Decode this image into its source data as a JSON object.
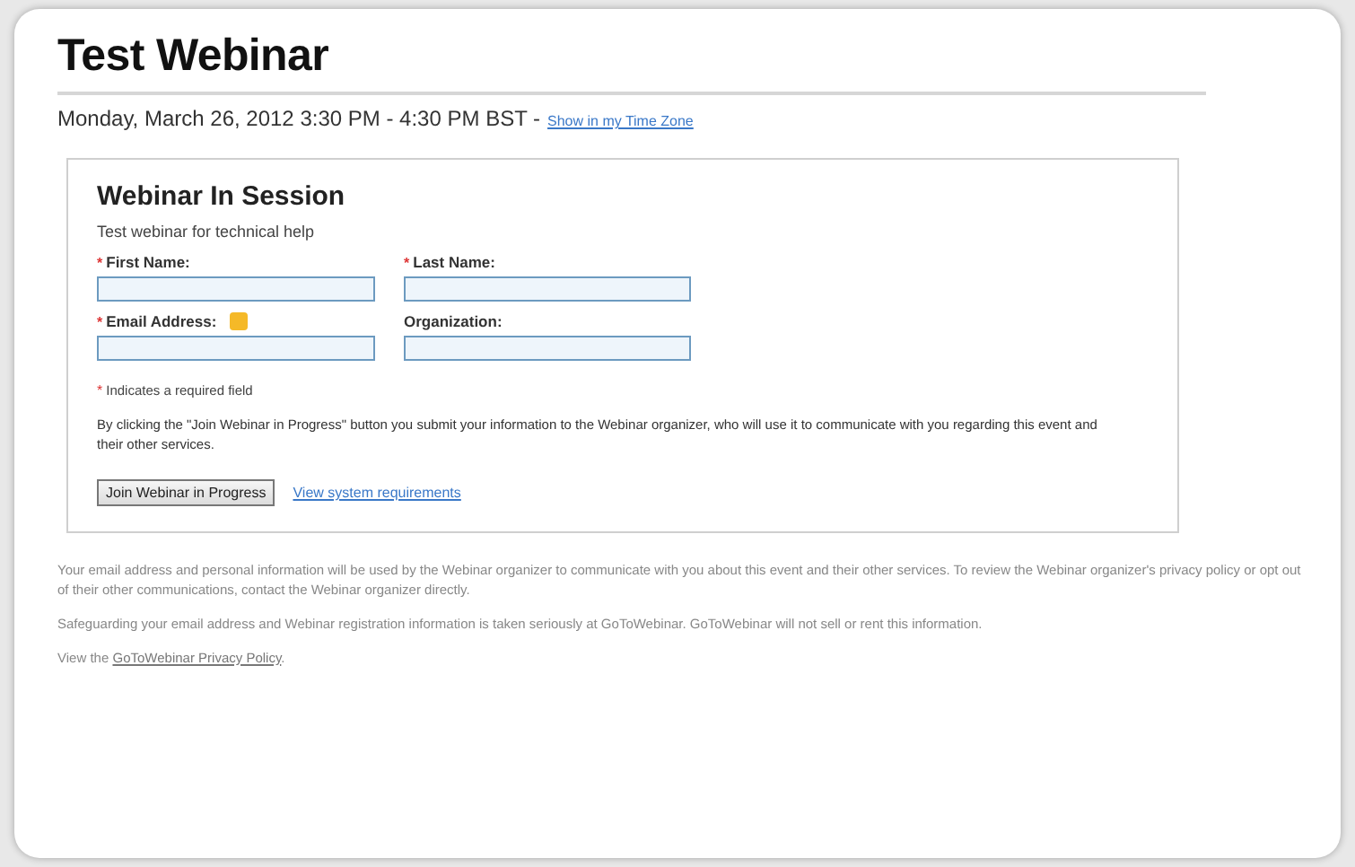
{
  "title": "Test Webinar",
  "schedule": {
    "text": "Monday, March 26, 2012 3:30 PM - 4:30 PM BST -",
    "link": "Show in my Time Zone"
  },
  "form": {
    "heading": "Webinar In Session",
    "description": "Test webinar for technical help",
    "fields": [
      {
        "label": "First Name:",
        "required": true,
        "info": false
      },
      {
        "label": "Last Name:",
        "required": true,
        "info": false
      },
      {
        "label": "Email Address:",
        "required": true,
        "info": true
      },
      {
        "label": "Organization:",
        "required": false,
        "info": false
      }
    ],
    "required_marker": "*",
    "required_note": "Indicates a required field",
    "consent": "By clicking the \"Join Webinar in Progress\" button you submit your information to the Webinar organizer, who will use it to communicate with you regarding this event and their other services.",
    "button": "Join Webinar in Progress",
    "link": "View system requirements"
  },
  "footer": {
    "paragraphs": [
      "Your email address and personal information will be used by the Webinar organizer to communicate with you about this event and their other services. To review the Webinar organizer's privacy policy or opt out of their other communications, contact the Webinar organizer directly.",
      "Safeguarding your email address and Webinar registration information is taken seriously at GoToWebinar. GoToWebinar will not sell or rent this information."
    ],
    "policy": {
      "prefix": "View the",
      "link": "GoToWebinar Privacy Policy",
      "suffix": "."
    }
  }
}
